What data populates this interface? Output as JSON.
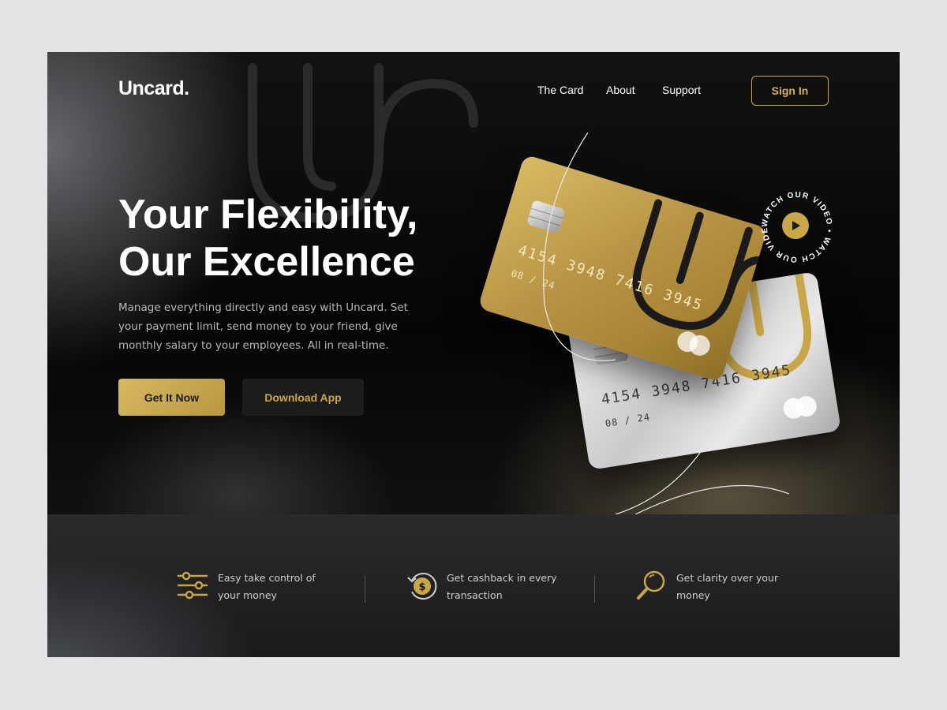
{
  "brand": {
    "logo": "Uncard."
  },
  "nav": {
    "links": [
      "The Card",
      "About",
      "Support"
    ],
    "signin_label": "Sign In"
  },
  "hero": {
    "headline_line1": "Your Flexibility,",
    "headline_line2": "Our Excellence",
    "description": "Manage everything directly and easy with Uncard. Set your payment limit, send money to your friend, give monthly salary to your employees. All in real-time.",
    "primary_cta": "Get It Now",
    "secondary_cta": "Download App"
  },
  "cards": [
    {
      "style": "gold",
      "number": "4154 3948 7416 3945",
      "expiry": "08 / 24"
    },
    {
      "style": "silver",
      "number": "4154 3948 7416 3945",
      "expiry": "08 / 24"
    }
  ],
  "video": {
    "label": "WATCH OUR VIDEO • WATCH OUR VIDEO •",
    "icon": "play-icon"
  },
  "features": [
    {
      "icon": "sliders-icon",
      "text": "Easy take control of your money"
    },
    {
      "icon": "cashback-icon",
      "text": "Get cashback in every transaction"
    },
    {
      "icon": "magnifier-icon",
      "text": "Get clarity over your money"
    }
  ],
  "colors": {
    "accent_gold": "#c9a646",
    "background": "#0a0a0a",
    "outer_background": "#e4e4e6"
  }
}
